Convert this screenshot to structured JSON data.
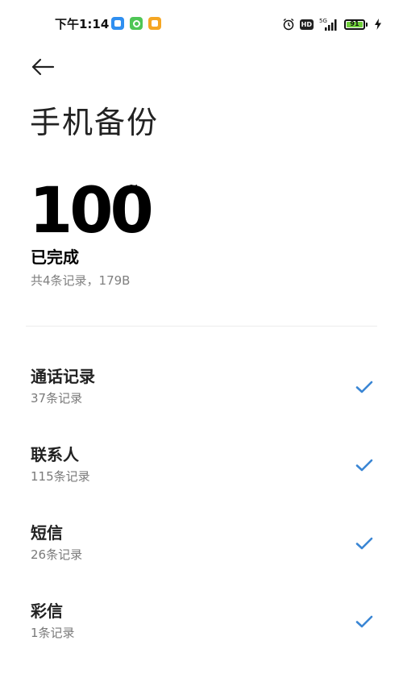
{
  "status_bar": {
    "time": "下午1:14",
    "network": "5G",
    "battery_level": "91",
    "notification_icons": [
      "blue-app-icon",
      "green-app-icon",
      "orange-app-icon"
    ],
    "right_icons": [
      "alarm-icon",
      "hd-icon",
      "signal-icon",
      "battery-icon",
      "charging-bolt-icon"
    ],
    "hd_label": "HD"
  },
  "header": {
    "back_icon": "back-arrow-icon",
    "title": "手机备份"
  },
  "progress": {
    "value": "100",
    "unit": "%",
    "status": "已完成",
    "summary": "共4条记录，179B"
  },
  "items": [
    {
      "title": "通话记录",
      "subtitle": "37条记录",
      "icon": "check-icon"
    },
    {
      "title": "联系人",
      "subtitle": "115条记录",
      "icon": "check-icon"
    },
    {
      "title": "短信",
      "subtitle": "26条记录",
      "icon": "check-icon"
    },
    {
      "title": "彩信",
      "subtitle": "1条记录",
      "icon": "check-icon"
    }
  ],
  "colors": {
    "accent": "#3a86d4",
    "secondary_text": "#808080",
    "battery_fill": "#6fcf3a"
  }
}
